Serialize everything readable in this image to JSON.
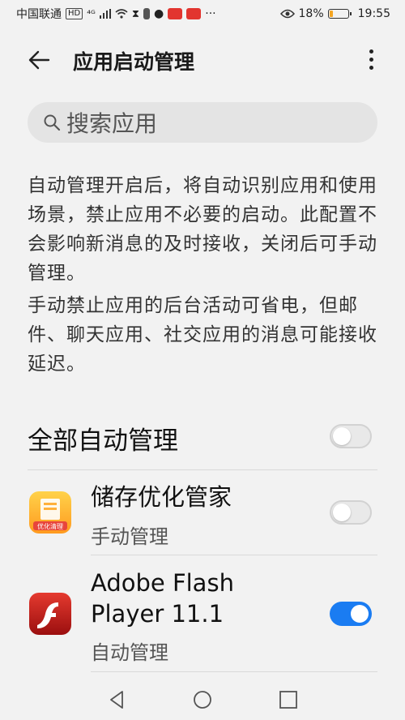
{
  "status_bar": {
    "carrier": "中国联通",
    "hd": "HD",
    "signal": "⁴ᴳ",
    "battery_percent": "18%",
    "battery_level": 0.18,
    "time": "19:55",
    "more": "···"
  },
  "header": {
    "title": "应用启动管理"
  },
  "search": {
    "placeholder": "搜索应用"
  },
  "description": {
    "para1": "自动管理开启后，将自动识别应用和使用场景，禁止应用不必要的启动。此配置不会影响新消息的及时接收，关闭后可手动管理。",
    "para2": "手动禁止应用的后台活动可省电，但邮件、聊天应用、社交应用的消息可能接收延迟。"
  },
  "all_auto": {
    "label": "全部自动管理",
    "enabled": false
  },
  "apps": [
    {
      "name": "储存优化管家",
      "status": "手动管理",
      "icon_text": "优化清理",
      "enabled": false
    },
    {
      "name": "Adobe Flash Player 11.1",
      "status": "自动管理",
      "enabled": true
    }
  ],
  "colors": {
    "accent": "#1a7cf2",
    "background": "#f2f2f2"
  }
}
